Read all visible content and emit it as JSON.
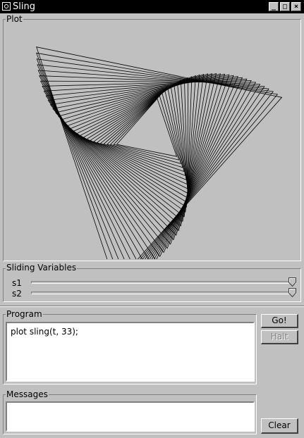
{
  "window": {
    "title": "Sling"
  },
  "plot": {
    "label": "Plot"
  },
  "sliders": {
    "label": "Sliding Variables",
    "items": [
      {
        "name": "s1",
        "value": 1.0
      },
      {
        "name": "s2",
        "value": 1.0
      }
    ]
  },
  "program": {
    "label": "Program",
    "code": "plot sling(t, 33);"
  },
  "messages": {
    "label": "Messages",
    "text": ""
  },
  "buttons": {
    "go": "Go!",
    "halt": "Halt",
    "clear": "Clear"
  },
  "icons": {
    "minimize": "minimize-icon",
    "maximize": "maximize-icon",
    "close": "close-icon"
  }
}
